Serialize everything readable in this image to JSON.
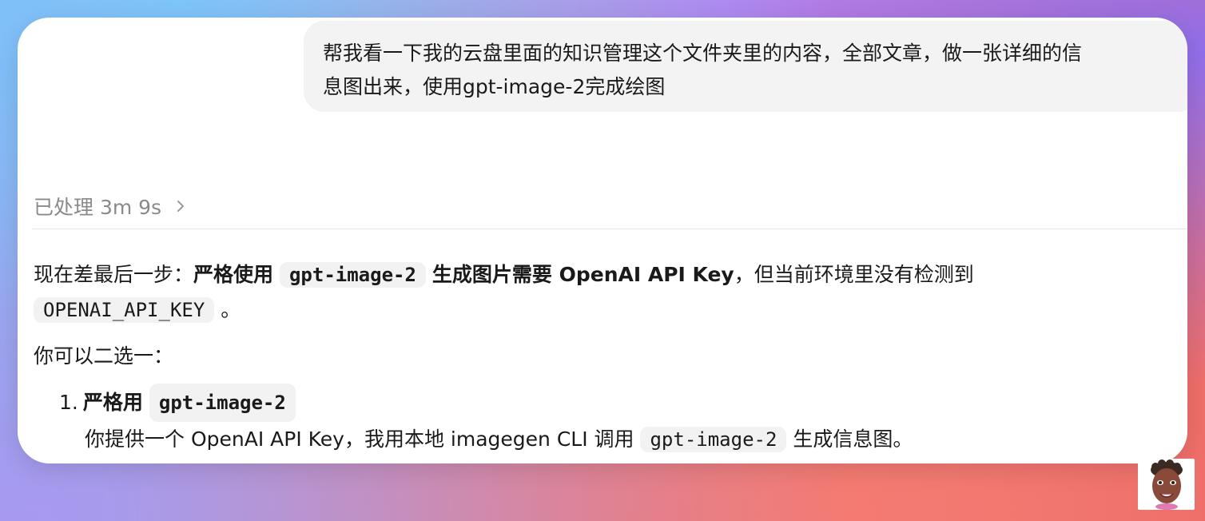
{
  "user_message": {
    "line1": "帮我看一下我的云盘里面的知识管理这个文件夹里的内容，全部文章，做一张详细的信",
    "line2": "息图出来，使用gpt-image-2完成绘图"
  },
  "status": {
    "label": "已处理 3m 9s",
    "chevron_icon": "chevron-right-icon"
  },
  "answer": {
    "p1_prefix": "现在差最后一步：",
    "p1_bold_a": "严格使用",
    "p1_code_model": "gpt-image-2",
    "p1_bold_b": "生成图片需要 OpenAI API Key",
    "p1_suffix": "，但当前环境里没有检测到",
    "p1_code_env": "OPENAI_API_KEY",
    "p1_end": "。",
    "p2": "你可以二选一：",
    "option1": {
      "number": "1.",
      "title_bold": "严格用",
      "title_code": "gpt-image-2",
      "body_prefix": "你提供一个 OpenAI API Key，我用本地 imagegen CLI 调用",
      "body_code": "gpt-image-2",
      "body_suffix": "生成信息图。"
    }
  },
  "avatar": {
    "icon": "memoji-avatar-icon"
  },
  "colors": {
    "bubble_bg": "#f3f3f3",
    "code_bg": "#f2f2f2",
    "status_text": "#8a8a8a",
    "text": "#1a1a1a"
  }
}
